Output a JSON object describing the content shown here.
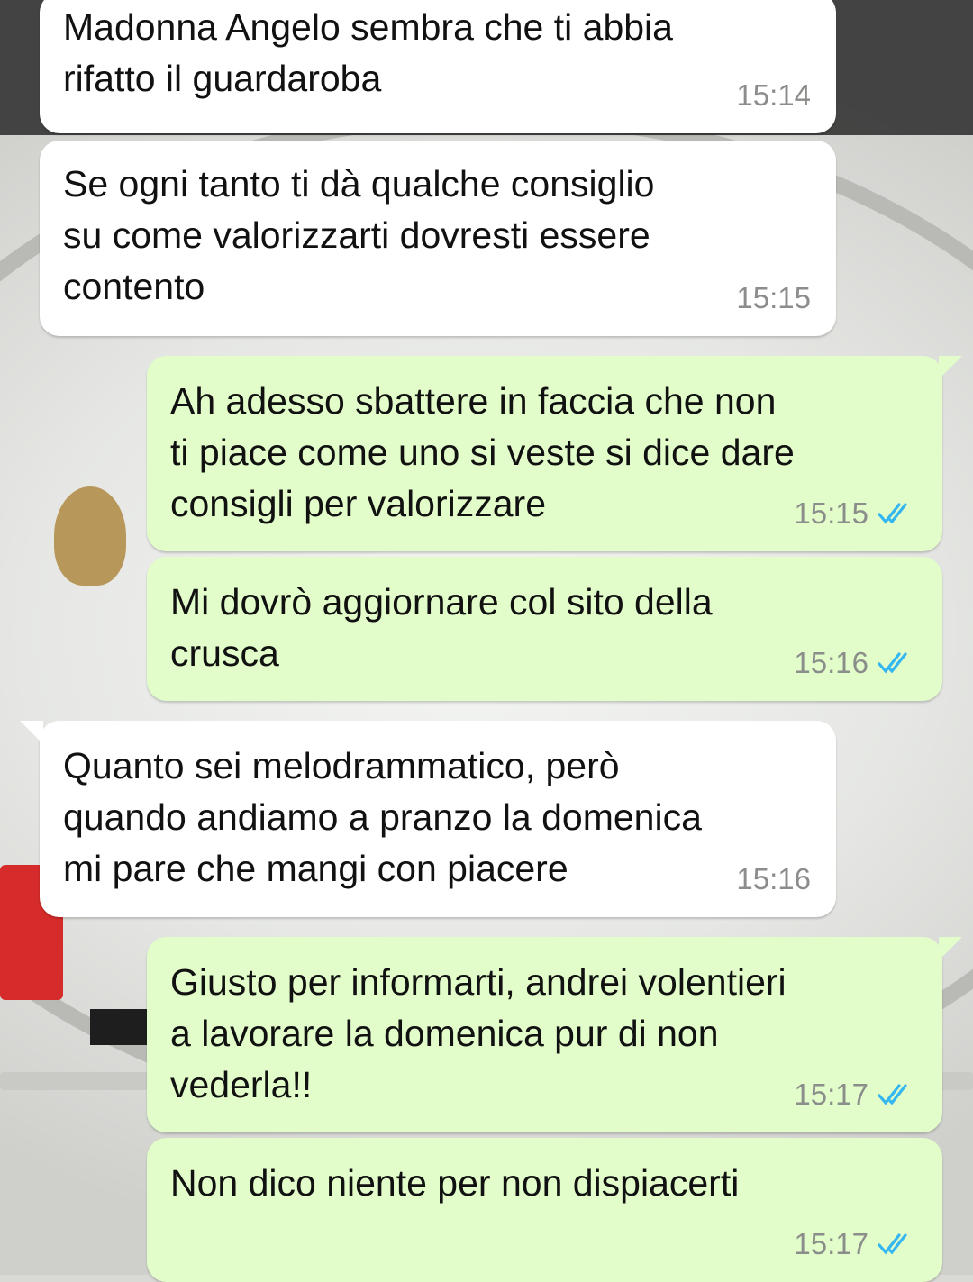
{
  "messages": [
    {
      "direction": "in",
      "text": "Madonna Angelo sembra che ti abbia\nrifatto il guardaroba",
      "time": "15:14"
    },
    {
      "direction": "in",
      "text": "Se ogni tanto ti dà qualche consiglio\nsu come valorizzarti dovresti essere\ncontento",
      "time": "15:15"
    },
    {
      "direction": "out",
      "text": "Ah adesso sbattere in faccia che non\nti piace come uno si veste si dice dare\nconsigli per valorizzare",
      "time": "15:15",
      "status_icon": "double-check-read-icon"
    },
    {
      "direction": "out",
      "text": "Mi dovrò aggiornare col sito della\ncrusca",
      "time": "15:16",
      "status_icon": "double-check-read-icon"
    },
    {
      "direction": "in",
      "text": "Quanto sei melodrammatico, però\nquando andiamo a pranzo la domenica\nmi pare che mangi con piacere",
      "time": "15:16"
    },
    {
      "direction": "out",
      "text": "Giusto per informarti, andrei volentieri\na lavorare la domenica pur di non\nvederla!!",
      "time": "15:17",
      "status_icon": "double-check-read-icon"
    },
    {
      "direction": "out",
      "text": "Non dico niente per non dispiacerti",
      "time": "15:17",
      "status_icon": "double-check-read-icon"
    }
  ],
  "colors": {
    "incoming_bubble": "#ffffff",
    "outgoing_bubble": "#e2fdca",
    "timestamp": "#8a8d89",
    "read_tick": "#34b7f1"
  }
}
